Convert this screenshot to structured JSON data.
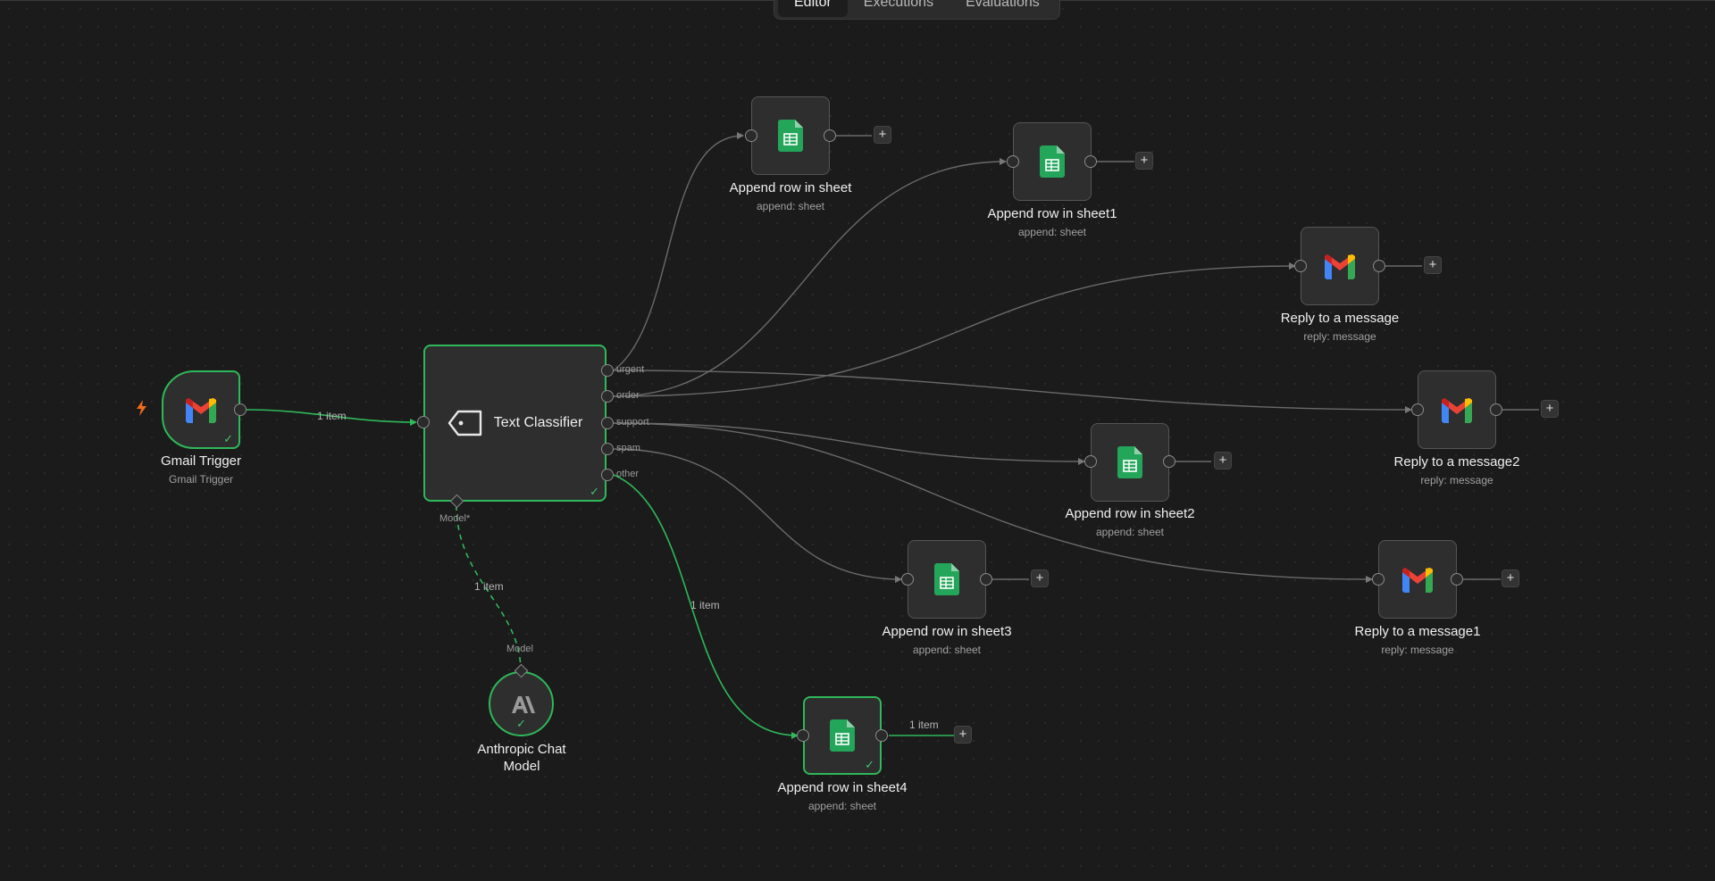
{
  "tabs": {
    "editor": "Editor",
    "executions": "Executions",
    "evaluations": "Evaluations"
  },
  "nodes": {
    "gmail_trigger": {
      "title": "Gmail Trigger",
      "subtitle": "Gmail Trigger",
      "icon": "gmail-icon",
      "status": "success"
    },
    "text_classifier": {
      "title": "Text Classifier",
      "icon": "tag-icon",
      "status": "success",
      "model_input": "Model*",
      "outputs": {
        "urgent": "urgent",
        "order": "order",
        "support": "support",
        "spam": "spam",
        "other": "other"
      }
    },
    "anthropic": {
      "title": "Anthropic Chat Model",
      "title_line1": "Anthropic Chat",
      "title_line2": "Model",
      "port_label": "Model",
      "icon": "anthropic-icon",
      "status": "success"
    },
    "append_row": {
      "title": "Append row in sheet",
      "subtitle": "append: sheet",
      "icon": "google-sheets-icon"
    },
    "append_row1": {
      "title": "Append row in sheet1",
      "subtitle": "append: sheet",
      "icon": "google-sheets-icon"
    },
    "append_row2": {
      "title": "Append row in sheet2",
      "subtitle": "append: sheet",
      "icon": "google-sheets-icon"
    },
    "append_row3": {
      "title": "Append row in sheet3",
      "subtitle": "append: sheet",
      "icon": "google-sheets-icon"
    },
    "append_row4": {
      "title": "Append row in sheet4",
      "subtitle": "append: sheet",
      "icon": "google-sheets-icon",
      "status": "success"
    },
    "reply": {
      "title": "Reply to a message",
      "subtitle": "reply: message",
      "icon": "gmail-icon"
    },
    "reply1": {
      "title": "Reply to a message1",
      "subtitle": "reply: message",
      "icon": "gmail-icon"
    },
    "reply2": {
      "title": "Reply to a message2",
      "subtitle": "reply: message",
      "icon": "gmail-icon"
    }
  },
  "edge_labels": {
    "trigger_to_classifier": "1 item",
    "model_link": "1 item",
    "other_to_sheet4": "1 item",
    "sheet4_out": "1 item"
  },
  "colors": {
    "success": "#2fb85a",
    "edge": "#6a6a6a",
    "sheets_green": "#23a55a",
    "trigger_bolt": "#f26b1d"
  }
}
